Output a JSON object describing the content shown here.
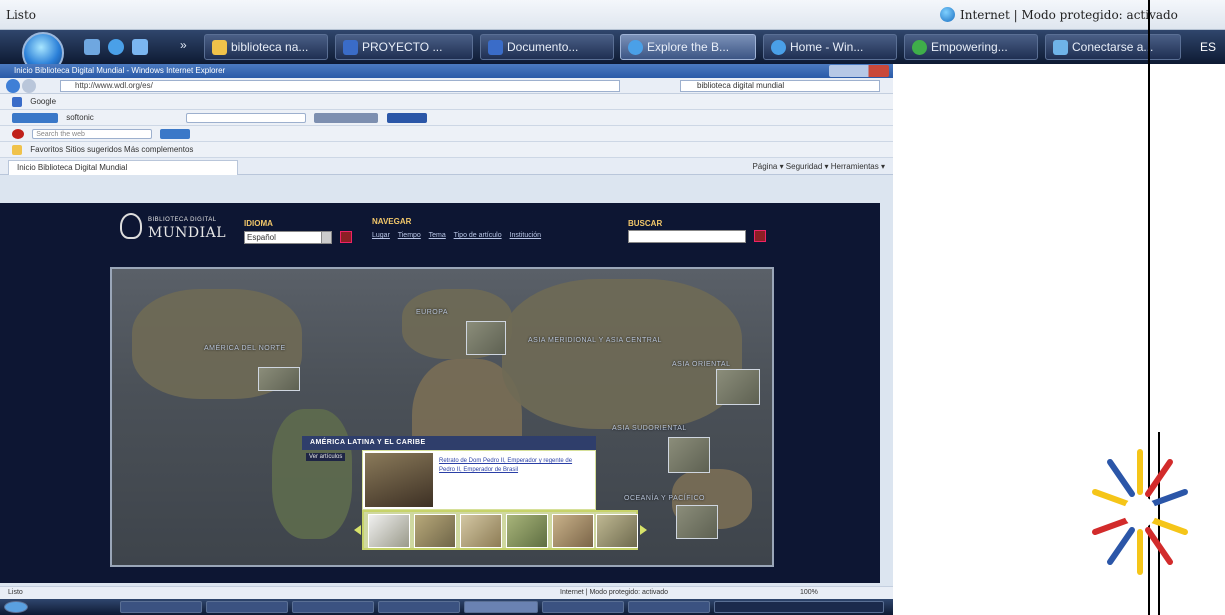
{
  "top_status": {
    "left_text": "Listo",
    "zone_text": "Internet | Modo protegido: activado"
  },
  "taskbar": {
    "start": "start-orb",
    "buttons": [
      {
        "label": "biblioteca na...",
        "icon": "folder-icon"
      },
      {
        "label": "PROYECTO ...",
        "icon": "word-icon"
      },
      {
        "label": "Documento...",
        "icon": "word-icon"
      },
      {
        "label": "Explore the B...",
        "icon": "ie-icon",
        "active": true
      },
      {
        "label": "Home - Win...",
        "icon": "ie-icon"
      },
      {
        "label": "Empowering...",
        "icon": "ie-icon"
      },
      {
        "label": "Conectarse a...",
        "icon": "network-icon"
      }
    ],
    "lang": "ES"
  },
  "embedded": {
    "window_title": "Inicio Biblioteca Digital Mundial - Windows Internet Explorer",
    "address": "http://www.wdl.org/es/",
    "search_text": "biblioteca digital mundial",
    "links_row": "Google",
    "softonic_row": "softonic",
    "yahoo_row": "Search the web",
    "fav_row": "Favoritos    Sitios sugeridos    Más complementos",
    "tab": "Inicio Biblioteca Digital Mundial",
    "cmd_bar": "Página ▾   Seguridad ▾   Herramientas ▾",
    "status_left": "Listo",
    "status_zone": "Internet | Modo protegido: activado",
    "status_zoom": "100%"
  },
  "wdl": {
    "logo_small": "BIBLIOTECA DIGITAL",
    "logo_big": "MUNDIAL",
    "idioma_label": "IDIOMA",
    "idioma_value": "Español",
    "navegar_label": "NAVEGAR",
    "nav_links": [
      "Lugar",
      "Tiempo",
      "Tema",
      "Tipo de artículo",
      "Institución"
    ],
    "buscar_label": "BUSCAR",
    "regions": [
      "AMÉRICA DEL NORTE",
      "EUROPA",
      "ASIA MERIDIONAL Y ASIA CENTRAL",
      "ASIA ORIENTAL",
      "ASIA SUDORIENTAL",
      "OCEANÍA Y PACÍFICO"
    ],
    "la_header": "AMÉRICA LATINA Y EL CARIBE",
    "la_sub": "Ver artículos",
    "la_caption": "Retrato de Dom Pedro II, Emperador y regente de Pedro II, Emperador de Brasil"
  },
  "colors": {
    "wdl_bg": "#0d1633",
    "accent_gold": "#f3c86a",
    "taskbar_top": "#30466c"
  }
}
